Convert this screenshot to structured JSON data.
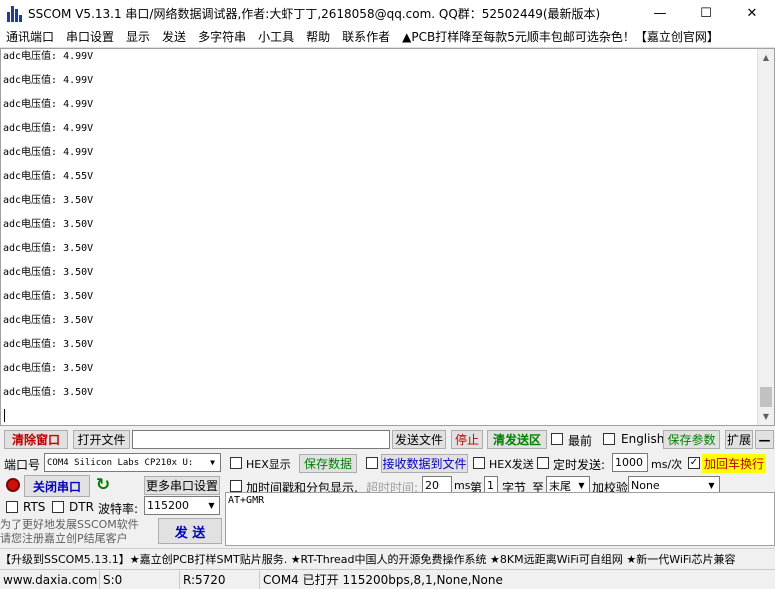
{
  "window": {
    "title": "SSCOM V5.13.1 串口/网络数据调试器,作者:大虾丁丁,2618058@qq.com. QQ群：52502449(最新版本)",
    "minimize": "—",
    "maximize": "☐",
    "close": "✕"
  },
  "menu": [
    "通讯端口",
    "串口设置",
    "显示",
    "发送",
    "多字符串",
    "小工具",
    "帮助",
    "联系作者",
    "▲PCB打样降至每款5元顺丰包邮可选杂色！【嘉立创官网】"
  ],
  "log": {
    "lines": [
      "adc电压值: 4.99V",
      "adc电压值: 4.99V",
      "adc电压值: 4.99V",
      "adc电压值: 4.99V",
      "adc电压值: 4.99V",
      "adc电压值: 4.55V",
      "adc电压值: 3.50V",
      "adc电压值: 3.50V",
      "adc电压值: 3.50V",
      "adc电压值: 3.50V",
      "adc电压值: 3.50V",
      "adc电压值: 3.50V",
      "adc电压值: 3.50V",
      "adc电压值: 3.50V",
      "adc电压值: 3.50V"
    ]
  },
  "toolbar1": {
    "clear_window": "清除窗口",
    "open_file": "打开文件",
    "file_path": "",
    "send_file": "发送文件",
    "stop": "停止",
    "clear_send": "清发送区",
    "topmost": "最前",
    "english": "English",
    "save_params": "保存参数",
    "expand": "扩展",
    "collapse": "—"
  },
  "port": {
    "label": "端口号",
    "value": "COM4 Silicon Labs CP210x U:",
    "hex_display": "HEX显示",
    "save_data": "保存数据",
    "recv_to_file": "接收数据到文件",
    "hex_send": "HEX发送",
    "timed_send": "定时发送:",
    "interval": "1000",
    "interval_unit": "ms/次",
    "add_crlf": "加回车换行",
    "close_port": "关闭串口",
    "more_settings": "更多串口设置",
    "timestamp": "加时间戳和分包显示,",
    "timeout_label": "超时时间:",
    "timeout_value": "20",
    "timeout_unit": "ms",
    "nth_label": "第",
    "nth_value": "1",
    "byte_label": "字节",
    "to_label": "至",
    "to_value": "末尾",
    "checksum_label": "加校验",
    "checksum_value": "None",
    "rts": "RTS",
    "dtr": "DTR",
    "baud_label": "波特率:",
    "baud_value": "115200",
    "send": "发 送",
    "send_text": "AT+GMR",
    "hint_line1": "为了更好地发展SSCOM软件",
    "hint_line2": "请您注册嘉立创P结尾客户"
  },
  "promo": "【升级到SSCOM5.13.1】★嘉立创PCB打样SMT贴片服务. ★RT-Thread中国人的开源免费操作系统 ★8KM远距离WiFi可自组网 ★新一代WiFi芯片兼容",
  "status": {
    "site": "www.daxia.com",
    "sent": "S:0",
    "received": "R:5720",
    "port_state": "COM4 已打开  115200bps,8,1,None,None"
  },
  "colors": {
    "accent_red": "#c00000",
    "accent_green": "#008000",
    "accent_blue": "#0000c0",
    "highlight_yellow": "#ffff00"
  }
}
